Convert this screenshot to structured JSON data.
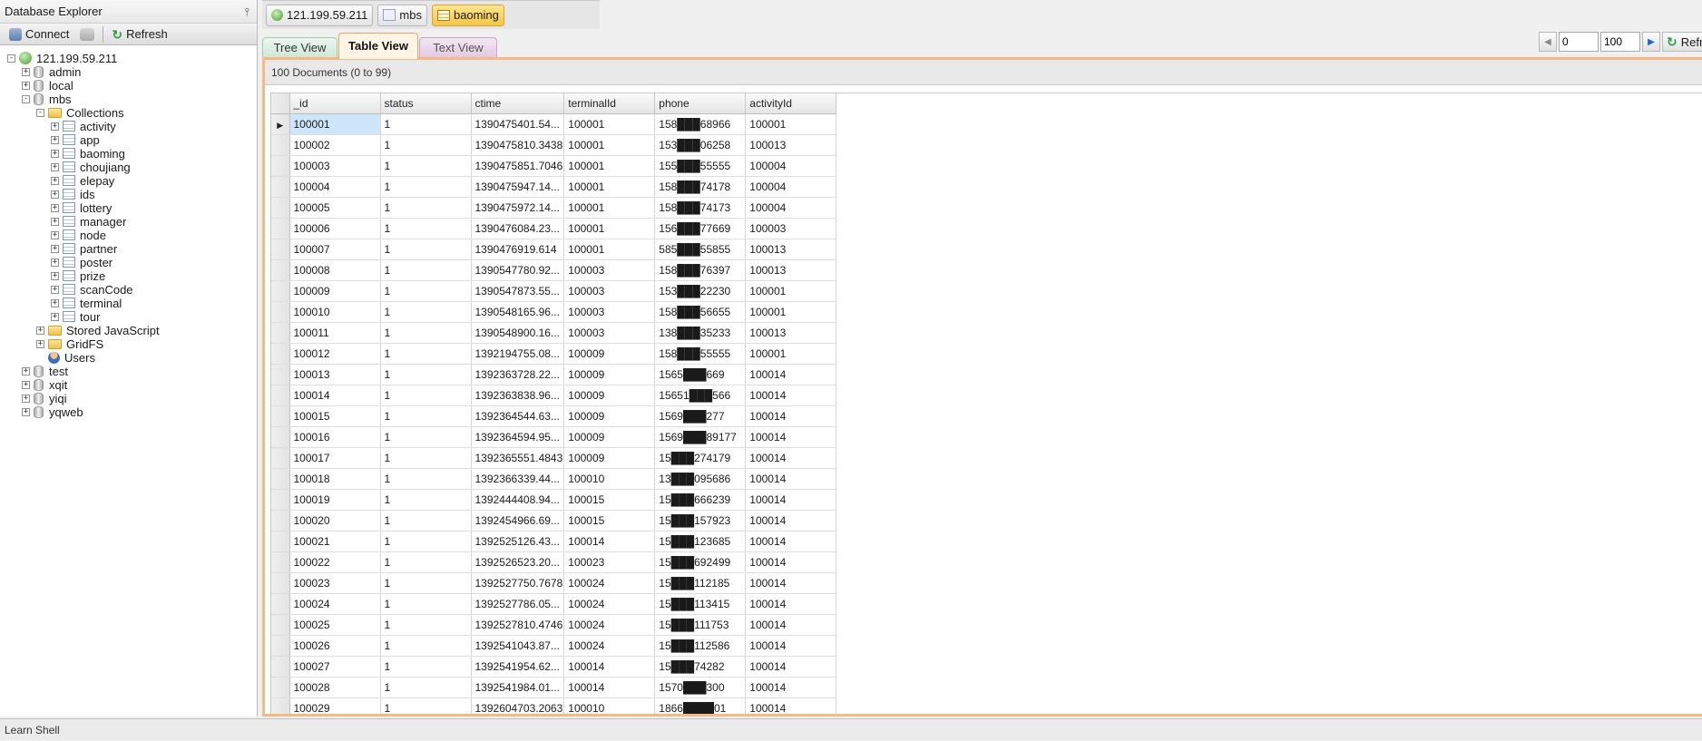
{
  "explorer": {
    "title": "Database Explorer",
    "toolbar": {
      "connect_label": "Connect",
      "refresh_label": "Refresh"
    },
    "tree": [
      {
        "label": "121.199.59.211",
        "level": 0,
        "icon": "server",
        "toggle": "-"
      },
      {
        "label": "admin",
        "level": 1,
        "icon": "db",
        "toggle": "+"
      },
      {
        "label": "local",
        "level": 1,
        "icon": "db",
        "toggle": "+"
      },
      {
        "label": "mbs",
        "level": 1,
        "icon": "db",
        "toggle": "-"
      },
      {
        "label": "Collections",
        "level": 2,
        "icon": "folder",
        "toggle": "-"
      },
      {
        "label": "activity",
        "level": 3,
        "icon": "collection",
        "toggle": "+"
      },
      {
        "label": "app",
        "level": 3,
        "icon": "collection",
        "toggle": "+"
      },
      {
        "label": "baoming",
        "level": 3,
        "icon": "collection",
        "toggle": "+"
      },
      {
        "label": "choujiang",
        "level": 3,
        "icon": "collection",
        "toggle": "+"
      },
      {
        "label": "elepay",
        "level": 3,
        "icon": "collection",
        "toggle": "+"
      },
      {
        "label": "ids",
        "level": 3,
        "icon": "collection",
        "toggle": "+"
      },
      {
        "label": "lottery",
        "level": 3,
        "icon": "collection",
        "toggle": "+"
      },
      {
        "label": "manager",
        "level": 3,
        "icon": "collection",
        "toggle": "+"
      },
      {
        "label": "node",
        "level": 3,
        "icon": "collection",
        "toggle": "+"
      },
      {
        "label": "partner",
        "level": 3,
        "icon": "collection",
        "toggle": "+"
      },
      {
        "label": "poster",
        "level": 3,
        "icon": "collection",
        "toggle": "+"
      },
      {
        "label": "prize",
        "level": 3,
        "icon": "collection",
        "toggle": "+"
      },
      {
        "label": "scanCode",
        "level": 3,
        "icon": "collection",
        "toggle": "+"
      },
      {
        "label": "terminal",
        "level": 3,
        "icon": "collection",
        "toggle": "+"
      },
      {
        "label": "tour",
        "level": 3,
        "icon": "collection",
        "toggle": "+"
      },
      {
        "label": "Stored JavaScript",
        "level": 2,
        "icon": "folder",
        "toggle": "+"
      },
      {
        "label": "GridFS",
        "level": 2,
        "icon": "folder",
        "toggle": "+"
      },
      {
        "label": "Users",
        "level": 2,
        "icon": "users",
        "toggle": ""
      },
      {
        "label": "test",
        "level": 1,
        "icon": "db",
        "toggle": "+"
      },
      {
        "label": "xqit",
        "level": 1,
        "icon": "db",
        "toggle": "+"
      },
      {
        "label": "yiqi",
        "level": 1,
        "icon": "db",
        "toggle": "+"
      },
      {
        "label": "yqweb",
        "level": 1,
        "icon": "db",
        "toggle": "+"
      }
    ]
  },
  "breadcrumb": {
    "server": "121.199.59.211",
    "database": "mbs",
    "collection": "baoming"
  },
  "view_tabs": {
    "tree": "Tree View",
    "table": "Table View",
    "text": "Text View"
  },
  "pager": {
    "skip": "0",
    "limit": "100",
    "refresh_label": "Refresh"
  },
  "grid": {
    "summary": "100 Documents (0 to 99)",
    "columns": [
      "_id",
      "status",
      "ctime",
      "terminalId",
      "phone",
      "activityId"
    ],
    "rows": [
      [
        "100001",
        "1",
        "1390475401.54...",
        "100001",
        "158███68966",
        "100001"
      ],
      [
        "100002",
        "1",
        "1390475810.3438",
        "100001",
        "153███06258",
        "100013"
      ],
      [
        "100003",
        "1",
        "1390475851.7046",
        "100001",
        "155███55555",
        "100004"
      ],
      [
        "100004",
        "1",
        "1390475947.14...",
        "100001",
        "158███74178",
        "100004"
      ],
      [
        "100005",
        "1",
        "1390475972.14...",
        "100001",
        "158███74173",
        "100004"
      ],
      [
        "100006",
        "1",
        "1390476084.23...",
        "100001",
        "156███77669",
        "100003"
      ],
      [
        "100007",
        "1",
        "1390476919.614",
        "100001",
        "585███55855",
        "100013"
      ],
      [
        "100008",
        "1",
        "1390547780.92...",
        "100003",
        "158███76397",
        "100013"
      ],
      [
        "100009",
        "1",
        "1390547873.55...",
        "100003",
        "153███22230",
        "100001"
      ],
      [
        "100010",
        "1",
        "1390548165.96...",
        "100003",
        "158███56655",
        "100001"
      ],
      [
        "100011",
        "1",
        "1390548900.16...",
        "100003",
        "138███35233",
        "100013"
      ],
      [
        "100012",
        "1",
        "1392194755.08...",
        "100009",
        "158███55555",
        "100001"
      ],
      [
        "100013",
        "1",
        "1392363728.22...",
        "100009",
        "1565███669",
        "100014"
      ],
      [
        "100014",
        "1",
        "1392363838.96...",
        "100009",
        "15651███566",
        "100014"
      ],
      [
        "100015",
        "1",
        "1392364544.63...",
        "100009",
        "1569███277",
        "100014"
      ],
      [
        "100016",
        "1",
        "1392364594.95...",
        "100009",
        "1569███89177",
        "100014"
      ],
      [
        "100017",
        "1",
        "1392365551.4843",
        "100009",
        "15███274179",
        "100014"
      ],
      [
        "100018",
        "1",
        "1392366339.44...",
        "100010",
        "13███095686",
        "100014"
      ],
      [
        "100019",
        "1",
        "1392444408.94...",
        "100015",
        "15███666239",
        "100014"
      ],
      [
        "100020",
        "1",
        "1392454966.69...",
        "100015",
        "15███157923",
        "100014"
      ],
      [
        "100021",
        "1",
        "1392525126.43...",
        "100014",
        "15███123685",
        "100014"
      ],
      [
        "100022",
        "1",
        "1392526523.20...",
        "100023",
        "15███692499",
        "100014"
      ],
      [
        "100023",
        "1",
        "1392527750.7678",
        "100024",
        "15███112185",
        "100014"
      ],
      [
        "100024",
        "1",
        "1392527786.05...",
        "100024",
        "15███113415",
        "100014"
      ],
      [
        "100025",
        "1",
        "1392527810.4746",
        "100024",
        "15███111753",
        "100014"
      ],
      [
        "100026",
        "1",
        "1392541043.87...",
        "100024",
        "15███112586",
        "100014"
      ],
      [
        "100027",
        "1",
        "1392541954.62...",
        "100014",
        "15███74282",
        "100014"
      ],
      [
        "100028",
        "1",
        "1392541984.01...",
        "100014",
        "1570███300",
        "100014"
      ],
      [
        "100029",
        "1",
        "1392604703.2063",
        "100010",
        "1866████01",
        "100014"
      ]
    ]
  },
  "statusbar": {
    "text": "Learn Shell"
  }
}
